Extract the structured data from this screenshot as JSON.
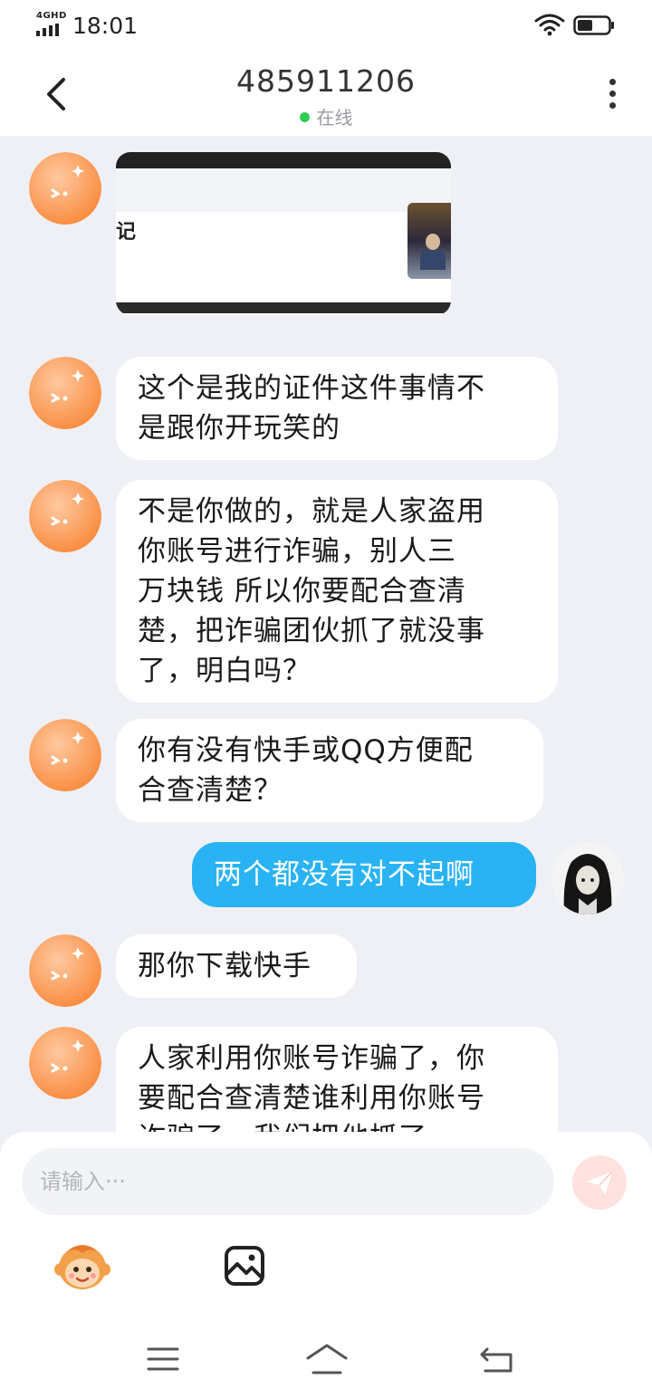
{
  "status_bar": {
    "network": "4GHD",
    "time": "18:01",
    "battery_level": 0.5
  },
  "header": {
    "title": "485911206",
    "status": "在线",
    "status_color": "#2ecc55"
  },
  "icons": {
    "back": "back-chevron-icon",
    "more": "more-vertical-icon",
    "send": "paper-plane-icon",
    "emoji": "monkey-emoji-icon",
    "image": "image-icon",
    "nav_menu": "menu-icon",
    "nav_home": "home-icon",
    "nav_back": "return-icon"
  },
  "image_message": {
    "visible_text": "记"
  },
  "messages": [
    {
      "sender": "other",
      "text": "这个是我的证件这件事情不\n是跟你开玩笑的"
    },
    {
      "sender": "other",
      "text": "不是你做的，就是人家盗用\n你账号进行诈骗，别人三\n万块钱 所以你要配合查清\n楚，把诈骗团伙抓了就没事\n了，明白吗？"
    },
    {
      "sender": "other",
      "text": "你有没有快手或QQ方便配\n合查清楚？"
    },
    {
      "sender": "me",
      "text": "两个都没有对不起啊"
    },
    {
      "sender": "other",
      "text": "那你下载快手"
    },
    {
      "sender": "other",
      "text": "人家利用你账号诈骗了，你\n要配合查清楚谁利用你账号\n诈骗了，我们把他抓了"
    }
  ],
  "input": {
    "placeholder": "请输入···"
  },
  "colors": {
    "accent_bubble": "#29b3f5",
    "background": "#eef0f6",
    "avatar": "#f98a3c"
  }
}
